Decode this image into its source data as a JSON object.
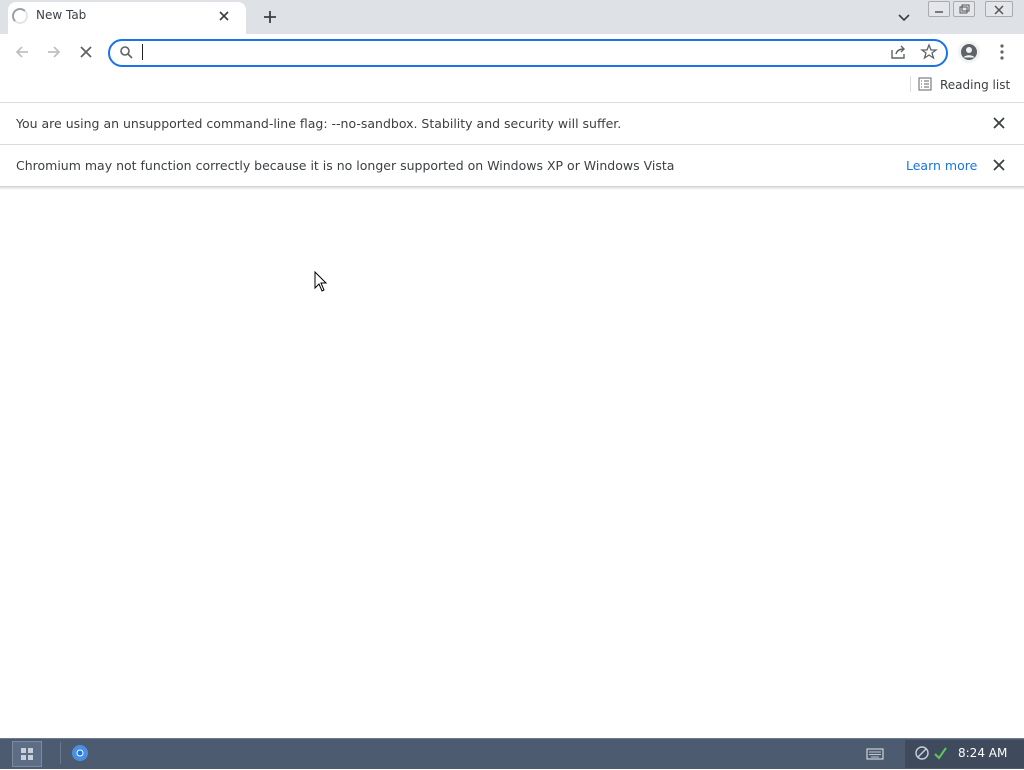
{
  "tab": {
    "title": "New Tab"
  },
  "omnibox": {
    "value": "",
    "placeholder": ""
  },
  "bookmarks": {
    "reading_list_label": "Reading list"
  },
  "infobars": [
    {
      "text": "You are using an unsupported command-line flag: --no-sandbox. Stability and security will suffer."
    },
    {
      "text": "Chromium may not function correctly because it is no longer supported on Windows XP or Windows Vista",
      "link": "Learn more"
    }
  ],
  "taskbar": {
    "clock": "8:24 AM"
  },
  "colors": {
    "accent": "#1a73e8",
    "tabstrip": "#dee1e6",
    "taskbar": "#4d5b70"
  },
  "icons": [
    "tab-loading-spinner-icon",
    "close-icon",
    "plus-icon",
    "chevron-down-icon",
    "back-arrow-icon",
    "forward-arrow-icon",
    "stop-icon",
    "search-icon",
    "share-icon",
    "star-icon",
    "profile-icon",
    "kebab-menu-icon",
    "reading-list-icon",
    "keyboard-icon",
    "chromium-icon"
  ]
}
